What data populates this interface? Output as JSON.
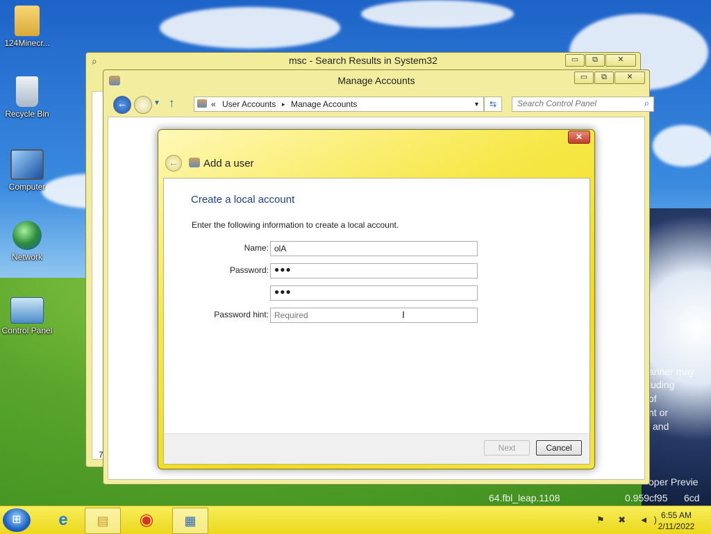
{
  "desktop": {
    "icons": [
      {
        "label": "124Minecr..."
      },
      {
        "label": "Recycle Bin"
      },
      {
        "label": "Computer"
      },
      {
        "label": "Network"
      },
      {
        "label": "Control Panel"
      }
    ],
    "wallpaper_text": [
      "anner may",
      "luding",
      "of",
      "nt or",
      "and",
      "oper Previe",
      "64.fbl_leap.1108",
      "0.959cf95",
      "6cd"
    ]
  },
  "back_window": {
    "title": "msc - Search Results in System32",
    "caption_buttons": [
      "▭",
      "⧉",
      "✕"
    ],
    "side_text": "7"
  },
  "main_window": {
    "title": "Manage Accounts",
    "caption_buttons": [
      "▭",
      "⧉",
      "✕"
    ],
    "address": {
      "chevron": "«",
      "crumbs": [
        "User Accounts",
        "Manage Accounts"
      ],
      "separator": "▸"
    },
    "search_placeholder": "Search Control Panel"
  },
  "dialog": {
    "title": "Add a user",
    "close_symbol": "✕",
    "back_symbol": "←",
    "heading": "Create a local account",
    "instructions": "Enter the following information to create a local account.",
    "fields": {
      "name_label": "Name:",
      "name_value": "olA",
      "password_label": "Password:",
      "password_value": "●●●",
      "confirm_value": "●●●",
      "hint_label": "Password hint:",
      "hint_placeholder": "Required"
    },
    "buttons": {
      "next": "Next",
      "cancel": "Cancel"
    }
  },
  "taskbar": {
    "start_glyph": "⊞",
    "apps": [
      {
        "name": "Internet Explorer",
        "glyph": "e"
      },
      {
        "name": "File Explorer",
        "glyph": "▤"
      },
      {
        "name": "Chrome",
        "glyph": "◉"
      },
      {
        "name": "Control Panel",
        "glyph": "▦"
      }
    ],
    "tray_glyphs": "⚑ ✖ ◄)",
    "time": "6:55 AM",
    "date": "2/11/2022"
  },
  "colors": {
    "accent": "#f0dc1c",
    "link_blue": "#1c3f94",
    "taskbar": "#ecd81c"
  }
}
